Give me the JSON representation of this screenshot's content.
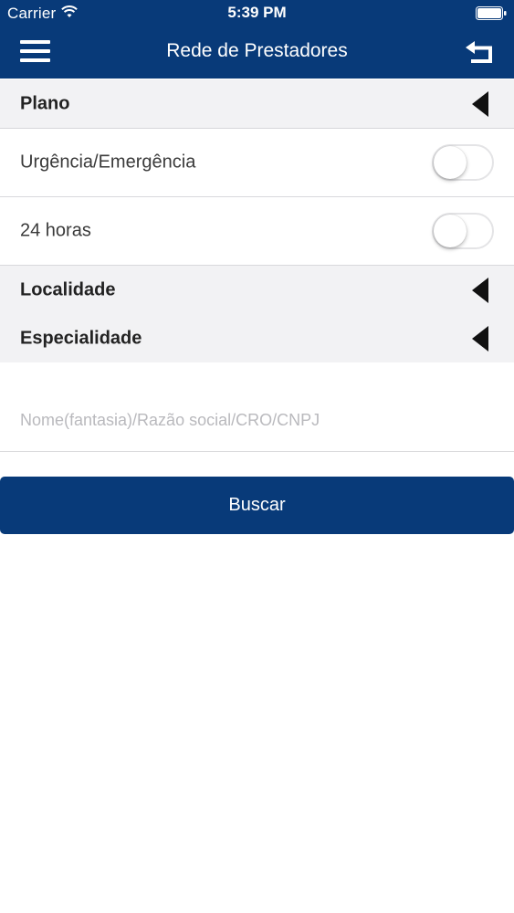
{
  "status_bar": {
    "carrier": "Carrier",
    "time": "5:39 PM"
  },
  "header": {
    "title": "Rede de Prestadores",
    "menu_icon": "hamburger-menu-icon",
    "back_icon": "return-arrow-icon",
    "background_color": "#083a79"
  },
  "filters": {
    "plano": {
      "label": "Plano",
      "icon": "caret-left-icon"
    },
    "urgencia": {
      "label": "Urgência/Emergência",
      "enabled": false
    },
    "vinte_quatro_horas": {
      "label": "24 horas",
      "enabled": false
    },
    "localidade": {
      "label": "Localidade",
      "icon": "caret-left-icon"
    },
    "especialidade": {
      "label": "Especialidade",
      "icon": "caret-left-icon"
    }
  },
  "search": {
    "value": "",
    "placeholder": "Nome(fantasia)/Razão social/CRO/CNPJ"
  },
  "actions": {
    "search_label": "Buscar"
  },
  "colors": {
    "accent": "#083a79",
    "section_background": "#f2f2f4"
  }
}
